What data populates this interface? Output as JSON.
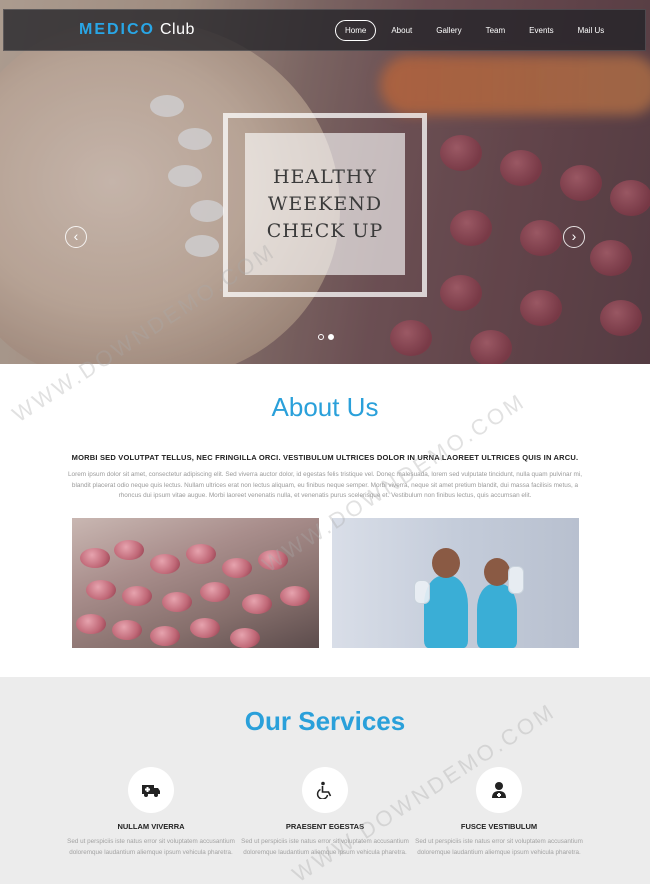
{
  "nav": {
    "brand_bold": "MEDICO",
    "brand_rest": "Club",
    "items": [
      "Home",
      "About",
      "Gallery",
      "Team",
      "Events",
      "Mail Us"
    ]
  },
  "hero": {
    "slide_title": "HEALTHY WEEKEND CHECK UP",
    "prev_arrow": "‹",
    "next_arrow": "›",
    "slide_count": 2,
    "active_slide": 2
  },
  "about": {
    "title": "About Us",
    "lead": "MORBI SED VOLUTPAT TELLUS, NEC FRINGILLA ORCI. VESTIBULUM ULTRICES DOLOR IN URNA LAOREET ULTRICES QUIS IN ARCU.",
    "body": "Lorem ipsum dolor sit amet, consectetur adipiscing elit. Sed viverra auctor dolor, id egestas felis tristique vel. Donec malesuada, lorem sed vulputate tincidunt, nulla quam pulvinar mi, blandit placerat odio neque quis lectus. Nullam ultrices erat non lectus aliquam, eu finibus neque semper. Morbi viverra, neque sit amet pretium blandit, dui massa facilisis metus, a rhoncus dui ipsum vitae augue. Morbi laoreet venenatis nulla, et venenatis purus scelerisque et. Vestibulum non finibus lectus, quis accumsan elit."
  },
  "services": {
    "title": "Our Services",
    "items": [
      {
        "name": "NULLAM VIVERRA",
        "icon": "ambulance-icon",
        "desc": "Sed ut perspiciis iste natus error sit voluptatem accusantium doloremque laudantium aliemque ipsum vehicula pharetra."
      },
      {
        "name": "PRAESENT EGESTAS",
        "icon": "wheelchair-icon",
        "desc": "Sed ut perspiciis iste natus error sit voluptatem accusantium doloremque laudantium aliemque ipsum vehicula pharetra."
      },
      {
        "name": "FUSCE VESTIBULUM",
        "icon": "doctor-icon",
        "desc": "Sed ut perspiciis iste natus error sit voluptatem accusantium doloremque laudantium aliemque ipsum vehicula pharetra."
      }
    ]
  },
  "watermark": "WWW.DOWNDEMO.COM",
  "colors": {
    "accent": "#2aa0da",
    "nav_bg": "#232328",
    "services_bg": "#ececec"
  }
}
